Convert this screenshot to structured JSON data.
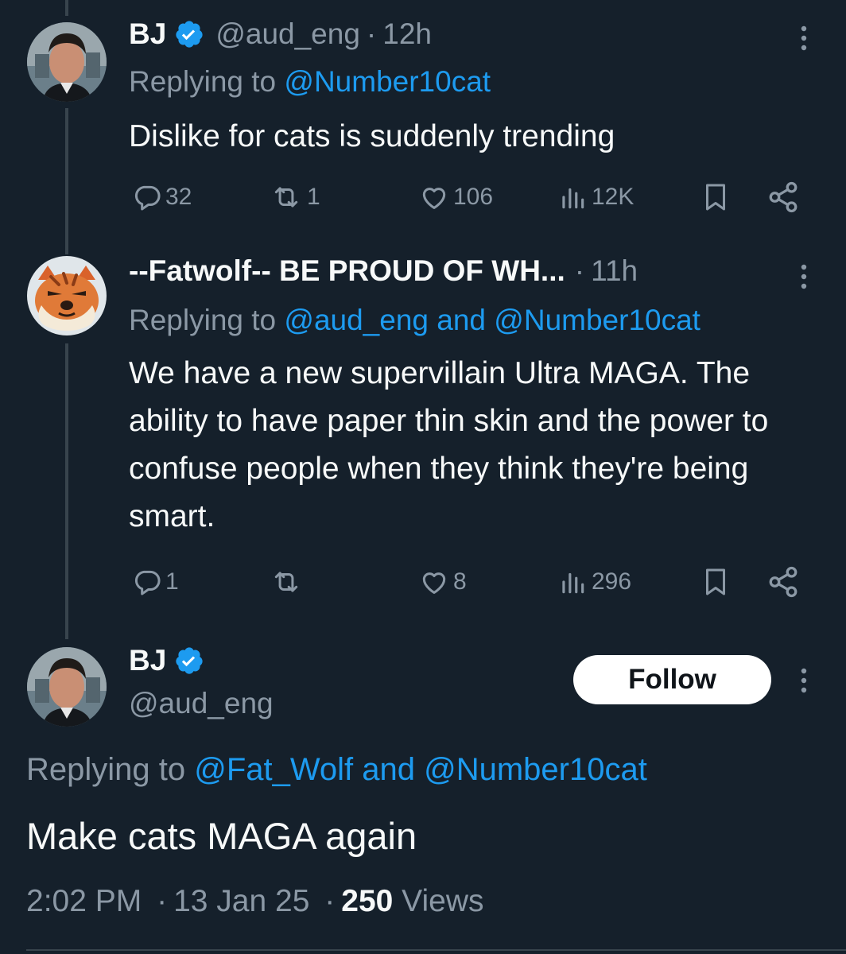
{
  "colors": {
    "background": "#15202b",
    "text": "#f7f9f9",
    "muted": "#8b98a5",
    "accent": "#1d9bf0",
    "verified": "#1d9bf0"
  },
  "tweets": [
    {
      "name": "BJ",
      "verified": true,
      "handle": "@aud_eng",
      "separator": "·",
      "time": "12h",
      "replying_prefix": "Replying to ",
      "replying_mentions": "@Number10cat",
      "text": "Dislike for cats is suddenly trending",
      "actions": {
        "replies": "32",
        "reposts": "1",
        "likes": "106",
        "views": "12K"
      },
      "icons": [
        "reply-icon",
        "repost-icon",
        "like-icon",
        "views-icon",
        "bookmark-icon",
        "share-icon",
        "more-icon"
      ]
    },
    {
      "name": "--Fatwolf-- BE PROUD OF WH...",
      "verified": false,
      "separator": "·",
      "time": "11h",
      "replying_prefix": "Replying to ",
      "replying_mentions": "@aud_eng and @Number10cat",
      "text": "We have a new supervillain Ultra MAGA. The ability to have paper thin skin and the power to confuse people when they think they're being smart.",
      "actions": {
        "replies": "1",
        "reposts": "",
        "likes": "8",
        "views": "296"
      }
    }
  ],
  "main_tweet": {
    "name": "BJ",
    "verified": true,
    "handle": "@aud_eng",
    "follow_label": "Follow",
    "replying_prefix": "Replying to ",
    "replying_mentions": "@Fat_Wolf and @Number10cat",
    "text": "Make cats MAGA again",
    "time": "2:02 PM",
    "separator": "·",
    "date": "13 Jan 25",
    "views_count": "250",
    "views_label": " Views"
  }
}
